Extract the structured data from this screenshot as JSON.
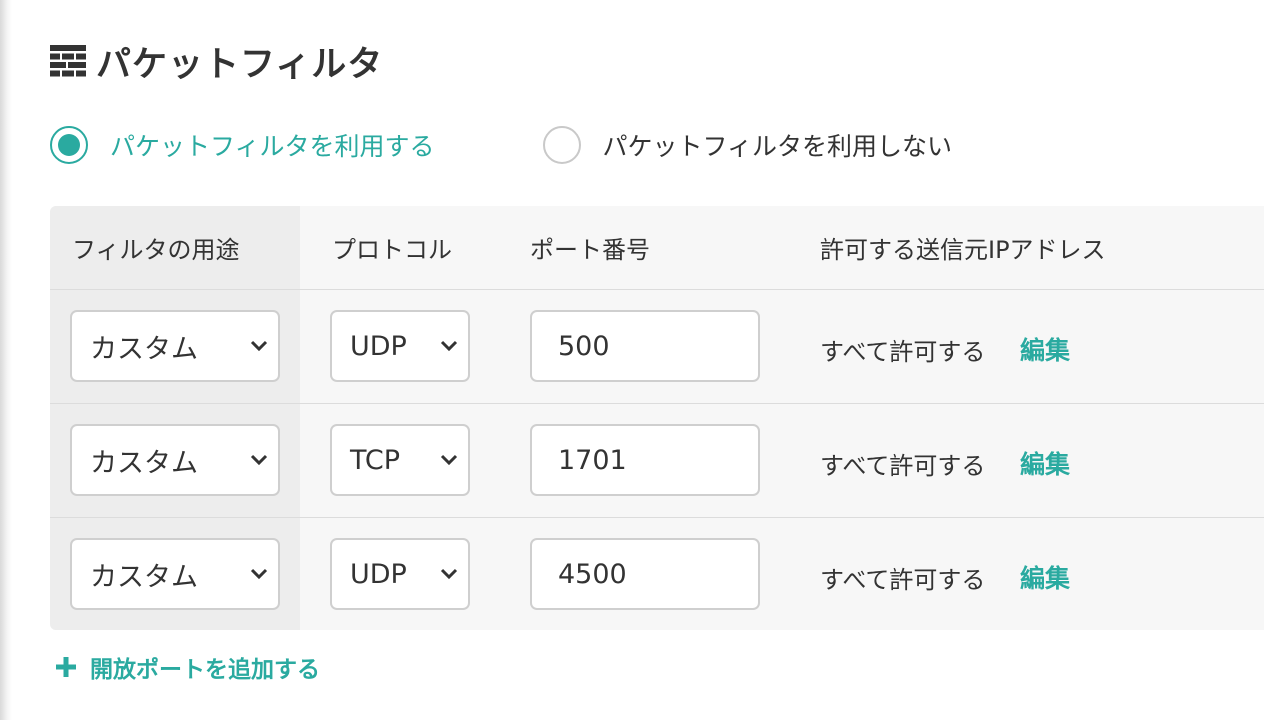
{
  "section": {
    "title": "パケットフィルタ",
    "icon": "brick-wall-icon"
  },
  "filter_mode": {
    "options": [
      {
        "label": "パケットフィルタを利用する",
        "checked": true
      },
      {
        "label": "パケットフィルタを利用しない",
        "checked": false
      }
    ]
  },
  "table": {
    "headers": {
      "usage": "フィルタの用途",
      "protocol": "プロトコル",
      "port": "ポート番号",
      "source_ip": "許可する送信元IPアドレス"
    },
    "rows": [
      {
        "usage": "カスタム",
        "protocol": "UDP",
        "port": "500",
        "source_ip": "すべて許可する",
        "edit_label": "編集"
      },
      {
        "usage": "カスタム",
        "protocol": "TCP",
        "port": "1701",
        "source_ip": "すべて許可する",
        "edit_label": "編集"
      },
      {
        "usage": "カスタム",
        "protocol": "UDP",
        "port": "4500",
        "source_ip": "すべて許可する",
        "edit_label": "編集"
      }
    ]
  },
  "add_port": {
    "label": "開放ポートを追加する",
    "icon": "plus-icon"
  },
  "colors": {
    "accent": "#2aaaa0",
    "text": "#333333",
    "table_bg": "#f7f7f7",
    "usage_column_bg": "#ededed"
  }
}
